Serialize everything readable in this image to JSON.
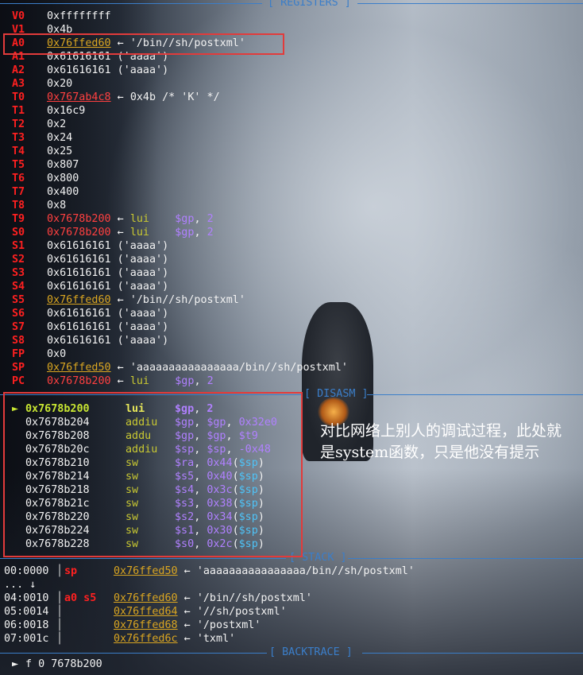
{
  "headers": {
    "registers": "[ REGISTERS ]",
    "disasm": "[ DISASM ]",
    "stack": "[ STACK ]",
    "backtrace": "[ BACKTRACE ]"
  },
  "registers": [
    {
      "name": "V0",
      "value": "0xffffffff",
      "kind": "plain",
      "desc": ""
    },
    {
      "name": "V1",
      "value": "0x4b",
      "kind": "plain",
      "desc": ""
    },
    {
      "name": "A0",
      "value": "0x76ffed60",
      "kind": "stack",
      "desc": "'/bin//sh/postxml'"
    },
    {
      "name": "A1",
      "value": "0x61616161 ('aaaa')",
      "kind": "plain",
      "desc": ""
    },
    {
      "name": "A2",
      "value": "0x61616161 ('aaaa')",
      "kind": "plain",
      "desc": ""
    },
    {
      "name": "A3",
      "value": "0x20",
      "kind": "plain",
      "desc": ""
    },
    {
      "name": "T0",
      "value": "0x767ab4c8",
      "kind": "code-u",
      "desc": "0x4b /* 'K' */"
    },
    {
      "name": "T1",
      "value": "0x16c9",
      "kind": "plain",
      "desc": ""
    },
    {
      "name": "T2",
      "value": "0x2",
      "kind": "plain",
      "desc": ""
    },
    {
      "name": "T3",
      "value": "0x24",
      "kind": "plain",
      "desc": ""
    },
    {
      "name": "T4",
      "value": "0x25",
      "kind": "plain",
      "desc": ""
    },
    {
      "name": "T5",
      "value": "0x807",
      "kind": "plain",
      "desc": ""
    },
    {
      "name": "T6",
      "value": "0x800",
      "kind": "plain",
      "desc": ""
    },
    {
      "name": "T7",
      "value": "0x400",
      "kind": "plain",
      "desc": ""
    },
    {
      "name": "T8",
      "value": "0x8",
      "kind": "plain",
      "desc": ""
    },
    {
      "name": "T9",
      "value": "0x7678b200",
      "kind": "code",
      "desc": "",
      "ins": "lui",
      "ops": "$gp",
      "imm": "2"
    },
    {
      "name": "S0",
      "value": "0x7678b200",
      "kind": "code",
      "desc": "",
      "ins": "lui",
      "ops": "$gp",
      "imm": "2"
    },
    {
      "name": "S1",
      "value": "0x61616161 ('aaaa')",
      "kind": "plain",
      "desc": ""
    },
    {
      "name": "S2",
      "value": "0x61616161 ('aaaa')",
      "kind": "plain",
      "desc": ""
    },
    {
      "name": "S3",
      "value": "0x61616161 ('aaaa')",
      "kind": "plain",
      "desc": ""
    },
    {
      "name": "S4",
      "value": "0x61616161 ('aaaa')",
      "kind": "plain",
      "desc": ""
    },
    {
      "name": "S5",
      "value": "0x76ffed60",
      "kind": "stack",
      "desc": "'/bin//sh/postxml'"
    },
    {
      "name": "S6",
      "value": "0x61616161 ('aaaa')",
      "kind": "plain",
      "desc": ""
    },
    {
      "name": "S7",
      "value": "0x61616161 ('aaaa')",
      "kind": "plain",
      "desc": ""
    },
    {
      "name": "S8",
      "value": "0x61616161 ('aaaa')",
      "kind": "plain",
      "desc": ""
    },
    {
      "name": "FP",
      "value": "0x0",
      "kind": "plain",
      "desc": ""
    },
    {
      "name": "SP",
      "value": "0x76ffed50",
      "kind": "stack",
      "desc": "'aaaaaaaaaaaaaaaa/bin//sh/postxml'"
    },
    {
      "name": "PC",
      "value": "0x7678b200",
      "kind": "code",
      "desc": "",
      "ins": "lui",
      "ops": "$gp",
      "imm": "2"
    }
  ],
  "disasm": [
    {
      "marker": "►",
      "addr": "0x7678b200",
      "ins": "lui",
      "ops": [
        [
          "$gp",
          "op"
        ],
        [
          ", ",
          "plain"
        ],
        [
          "2",
          "num"
        ]
      ],
      "current": true
    },
    {
      "marker": "",
      "addr": "0x7678b204",
      "ins": "addiu",
      "ops": [
        [
          "$gp",
          "op"
        ],
        [
          ", ",
          "plain"
        ],
        [
          "$gp",
          "op"
        ],
        [
          ", ",
          "plain"
        ],
        [
          "0x32e0",
          "num"
        ]
      ]
    },
    {
      "marker": "",
      "addr": "0x7678b208",
      "ins": "addu",
      "ops": [
        [
          "$gp",
          "op"
        ],
        [
          ", ",
          "plain"
        ],
        [
          "$gp",
          "op"
        ],
        [
          ", ",
          "plain"
        ],
        [
          "$t9",
          "op"
        ]
      ]
    },
    {
      "marker": "",
      "addr": "0x7678b20c",
      "ins": "addiu",
      "ops": [
        [
          "$sp",
          "op"
        ],
        [
          ", ",
          "plain"
        ],
        [
          "$sp",
          "op"
        ],
        [
          ", ",
          "plain"
        ],
        [
          "-0x48",
          "num"
        ]
      ]
    },
    {
      "marker": "",
      "addr": "0x7678b210",
      "ins": "sw",
      "ops": [
        [
          "$ra",
          "op"
        ],
        [
          ", ",
          "plain"
        ],
        [
          "0x44",
          "num"
        ],
        [
          "(",
          "plain"
        ],
        [
          "$sp",
          "sp"
        ],
        [
          ")",
          "plain"
        ]
      ]
    },
    {
      "marker": "",
      "addr": "0x7678b214",
      "ins": "sw",
      "ops": [
        [
          "$s5",
          "op"
        ],
        [
          ", ",
          "plain"
        ],
        [
          "0x40",
          "num"
        ],
        [
          "(",
          "plain"
        ],
        [
          "$sp",
          "sp"
        ],
        [
          ")",
          "plain"
        ]
      ]
    },
    {
      "marker": "",
      "addr": "0x7678b218",
      "ins": "sw",
      "ops": [
        [
          "$s4",
          "op"
        ],
        [
          ", ",
          "plain"
        ],
        [
          "0x3c",
          "num"
        ],
        [
          "(",
          "plain"
        ],
        [
          "$sp",
          "sp"
        ],
        [
          ")",
          "plain"
        ]
      ]
    },
    {
      "marker": "",
      "addr": "0x7678b21c",
      "ins": "sw",
      "ops": [
        [
          "$s3",
          "op"
        ],
        [
          ", ",
          "plain"
        ],
        [
          "0x38",
          "num"
        ],
        [
          "(",
          "plain"
        ],
        [
          "$sp",
          "sp"
        ],
        [
          ")",
          "plain"
        ]
      ]
    },
    {
      "marker": "",
      "addr": "0x7678b220",
      "ins": "sw",
      "ops": [
        [
          "$s2",
          "op"
        ],
        [
          ", ",
          "plain"
        ],
        [
          "0x34",
          "num"
        ],
        [
          "(",
          "plain"
        ],
        [
          "$sp",
          "sp"
        ],
        [
          ")",
          "plain"
        ]
      ]
    },
    {
      "marker": "",
      "addr": "0x7678b224",
      "ins": "sw",
      "ops": [
        [
          "$s1",
          "op"
        ],
        [
          ", ",
          "plain"
        ],
        [
          "0x30",
          "num"
        ],
        [
          "(",
          "plain"
        ],
        [
          "$sp",
          "sp"
        ],
        [
          ")",
          "plain"
        ]
      ]
    },
    {
      "marker": "",
      "addr": "0x7678b228",
      "ins": "sw",
      "ops": [
        [
          "$s0",
          "op"
        ],
        [
          ", ",
          "plain"
        ],
        [
          "0x2c",
          "num"
        ],
        [
          "(",
          "plain"
        ],
        [
          "$sp",
          "sp"
        ],
        [
          ")",
          "plain"
        ]
      ]
    }
  ],
  "annotation": "对比网络上别人的调试过程，此处就是system函数，只是他没有提示",
  "stack": [
    {
      "index": "00:0000",
      "regs": "sp",
      "addr": "0x76ffed50",
      "desc": "'aaaaaaaaaaaaaaaa/bin//sh/postxml'"
    },
    {
      "index": "... ↓",
      "regs": "",
      "addr": "",
      "desc": ""
    },
    {
      "index": "04:0010",
      "regs": "a0 s5",
      "addr": "0x76ffed60",
      "desc": "'/bin//sh/postxml'"
    },
    {
      "index": "05:0014",
      "regs": "",
      "addr": "0x76ffed64",
      "desc": "'//sh/postxml'"
    },
    {
      "index": "06:0018",
      "regs": "",
      "addr": "0x76ffed68",
      "desc": "'/postxml'"
    },
    {
      "index": "07:001c",
      "regs": "",
      "addr": "0x76ffed6c",
      "desc": "'txml'"
    }
  ],
  "backtrace": [
    {
      "marker": "►",
      "text": "f 0 7678b200"
    }
  ],
  "colors": {
    "register_name": "#ff2020",
    "stack_address": "#d9a521",
    "code_address": "#ff4040",
    "mnemonic": "#c8c832",
    "operand": "#b080ff",
    "header": "#3b7ec9",
    "highlight_box": "#e23b3b"
  }
}
